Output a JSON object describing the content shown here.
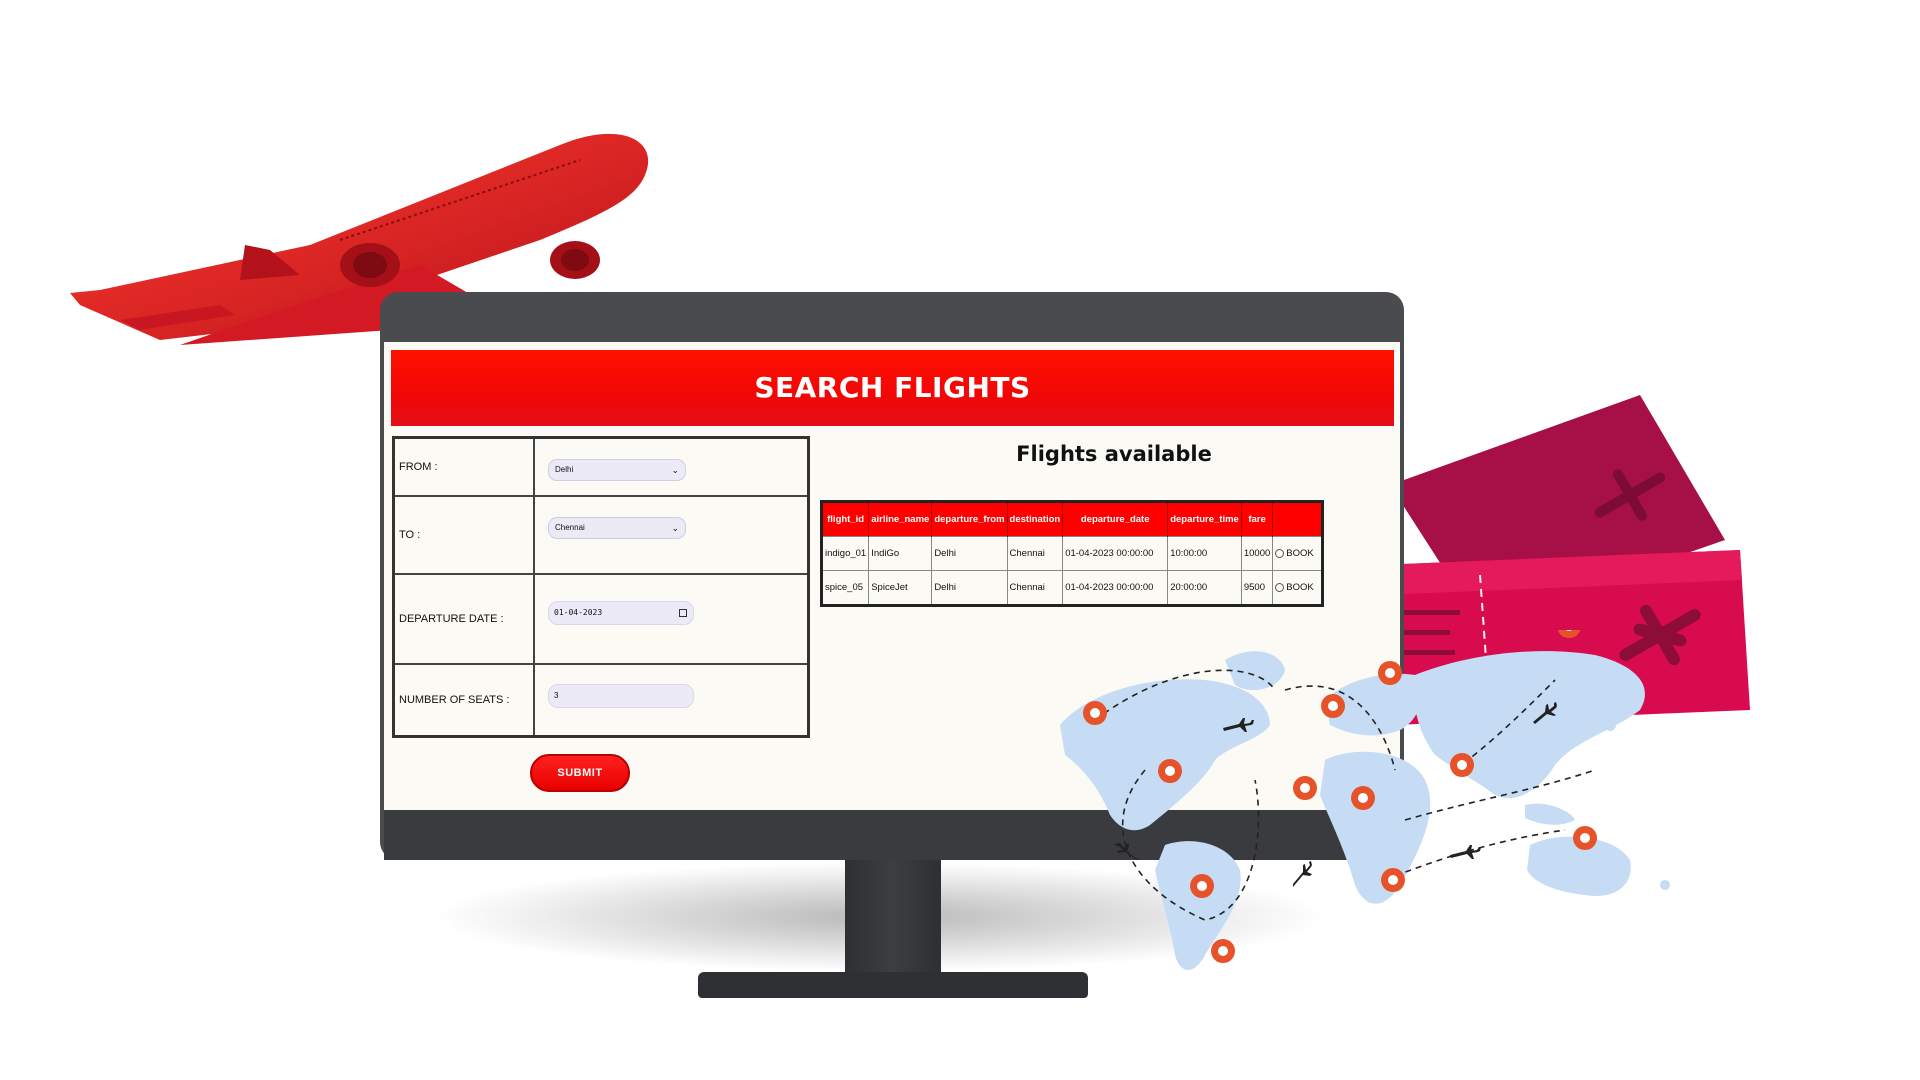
{
  "header": {
    "title": "SEARCH FLIGHTS"
  },
  "form": {
    "from_label": "FROM :",
    "from_value": "Delhi",
    "to_label": "TO :",
    "to_value": "Chennai",
    "date_label": "DEPARTURE DATE :",
    "date_value": "01-04-2023",
    "seats_label": "NUMBER OF SEATS :",
    "seats_value": "3",
    "submit_label": "SUBMIT"
  },
  "results": {
    "title": "Flights available",
    "columns": [
      "flight_id",
      "airline_name",
      "departure_from",
      "destination",
      "departure_date",
      "departure_time",
      "fare",
      ""
    ],
    "rows": [
      [
        "indigo_01",
        "IndiGo",
        "Delhi",
        "Chennai",
        "01-04-2023 00:00:00",
        "10:00:00",
        "10000",
        "BOOK"
      ],
      [
        "spice_05",
        "SpiceJet",
        "Delhi",
        "Chennai",
        "01-04-2023 00:00:00",
        "20:00:00",
        "9500",
        "BOOK"
      ]
    ]
  },
  "colors": {
    "header_red": "#ff1100",
    "monitor_bezel": "#4a4b4f",
    "map_blue": "#c6dcf4",
    "pin_orange": "#e6532a",
    "ticket_magenta": "#d90b4f"
  },
  "icons": [
    "airplane-icon",
    "ticket-icon",
    "world-map-icon",
    "map-pin-icon",
    "small-plane-icon",
    "calendar-icon",
    "chevron-down-icon",
    "radio-icon"
  ]
}
